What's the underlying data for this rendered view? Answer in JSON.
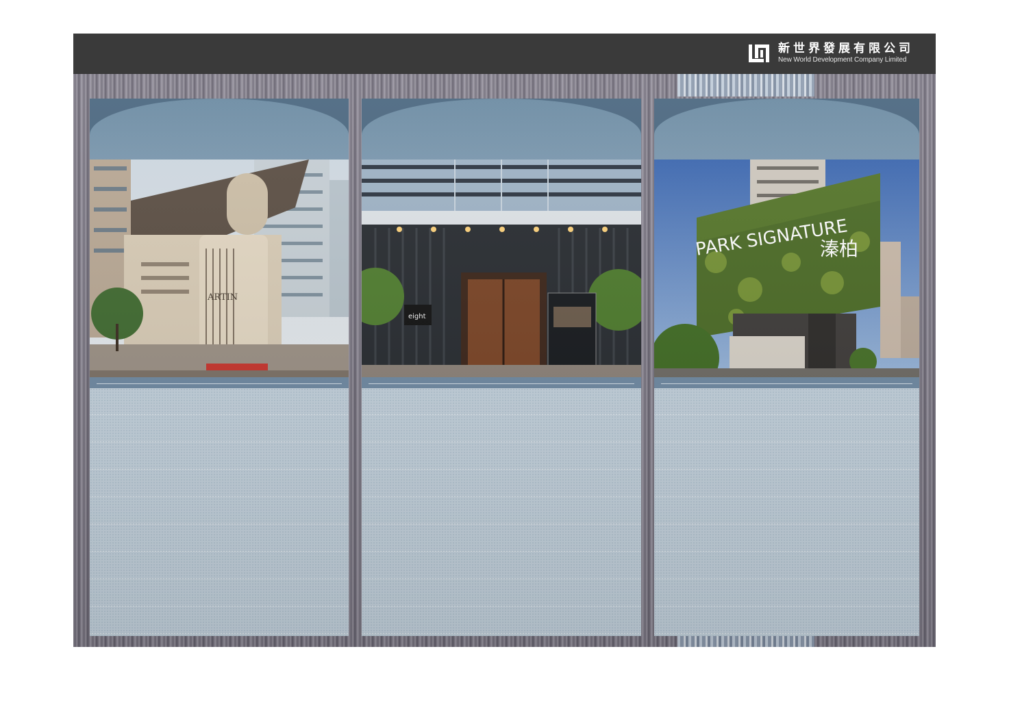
{
  "header": {
    "logo_cn": "新世界發展有限公司",
    "logo_en": "New World Development Company Limited"
  },
  "colors": {
    "header_bg": "#3a3a3a",
    "card_top": "#49667f",
    "card_body": "#c6d4df",
    "rule_band": "#6f8aa3"
  },
  "cards": [
    {
      "photo_sign": "ARTIN",
      "icon": "residential-tower-photo"
    },
    {
      "photo_sign": "eight",
      "icon": "building-entrance-photo"
    },
    {
      "photo_sign_en": "PARK SIGNATURE",
      "photo_sign_cn": "溱柏",
      "icon": "green-wall-photo"
    }
  ]
}
